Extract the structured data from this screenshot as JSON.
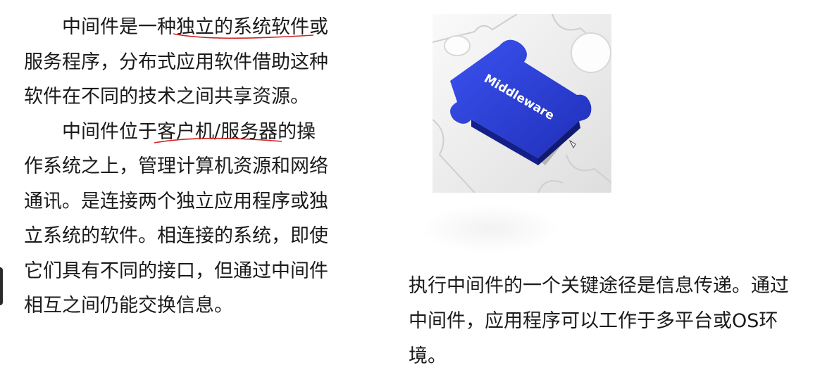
{
  "left_text": {
    "p1_before": "中间件是一种",
    "p1_highlight": "独立的系统软件",
    "p1_after": "或服务程序，分布式应用软件借助这种软件在不同的技术之间共享资源。",
    "p2_before": "中间件位于",
    "p2_highlight": "客户机/服务器",
    "p2_after": "的操作系统之上，管理计算机资源和网络通讯。是连接两个独立应用程序或独立系统的软件。相连接的系统，即使它们具有不同的接口，但通过中间件相互之间仍能交换信息。"
  },
  "right_text": {
    "line_a": "执行中间件的一个关键途径是信息传递。通过中间件，应用程序可以工作于多平台或",
    "os_label": "OS",
    "line_b": "环境。"
  },
  "image": {
    "label": "Middleware",
    "piece_color": "#2b3fd6",
    "board_color": "#f4f4f4"
  },
  "annotation_color": "#d22323"
}
